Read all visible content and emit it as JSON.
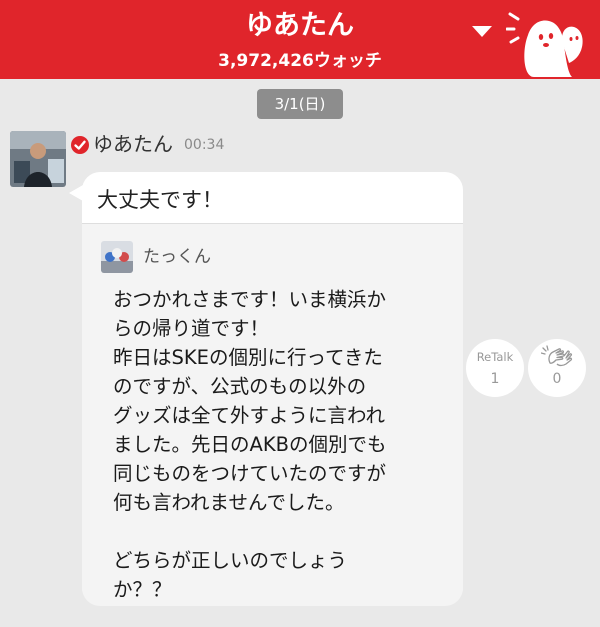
{
  "header": {
    "title": "ゆあたん",
    "watch_count": "3,972,426ウォッチ",
    "dropdown_icon": "chevron-down-icon",
    "mascot_icon": "mascot-icon",
    "accent_color": "#e0252b"
  },
  "date_separator": "3/1(日)",
  "message": {
    "sender": "ゆあたん",
    "time": "00:34",
    "verified_icon": "verified-check-icon",
    "reply": "大丈夫です！",
    "quoted": {
      "name": "たっくん",
      "lines": [
        "おつかれさまです！いま横浜か",
        "らの帰り道です！",
        "昨日はSKEの個別に行ってきた",
        "のですが、公式のもの以外の",
        "グッズは全て外すように言われ",
        "ました。先日のAKBの個別でも",
        "同じものをつけていたのですが",
        "何も言われませんでした。",
        "",
        "どちらが正しいのでしょう",
        "か？？"
      ]
    }
  },
  "actions": {
    "retalk_label": "ReTalk",
    "retalk_count": "1",
    "clap_icon": "clap-icon",
    "clap_count": "0"
  }
}
